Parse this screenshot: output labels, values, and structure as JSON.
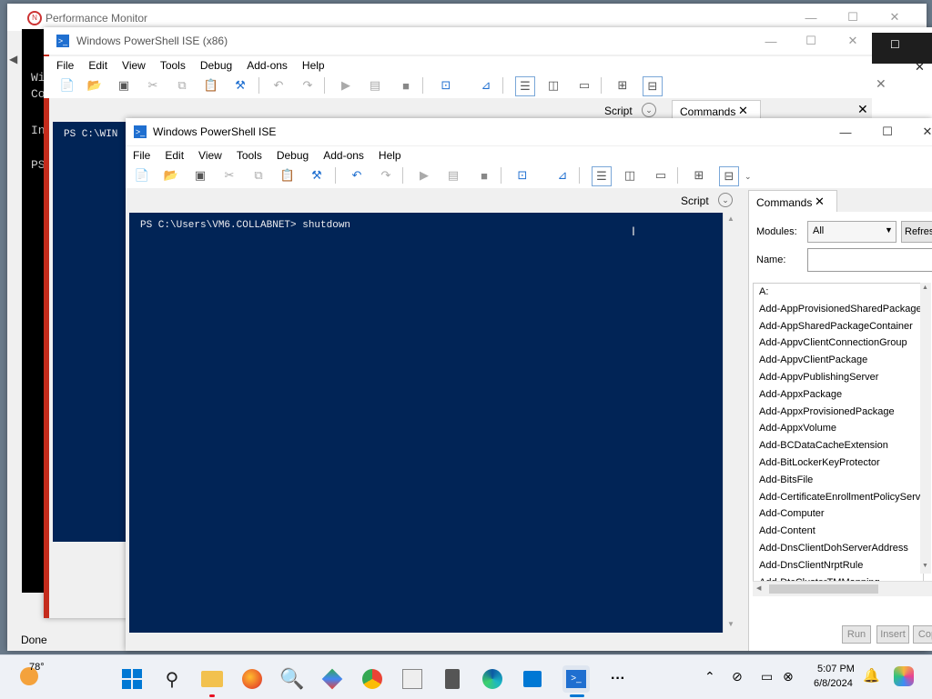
{
  "perfmon": {
    "title": "Performance Monitor",
    "status": "Done"
  },
  "bg_console": {
    "lines": [
      "Wi",
      "Co",
      "In",
      "PS"
    ]
  },
  "ise_back": {
    "title": "Windows PowerShell ISE (x86)",
    "menu": [
      "File",
      "Edit",
      "View",
      "Tools",
      "Debug",
      "Add-ons",
      "Help"
    ],
    "script_label": "Script",
    "commands_tab": "Commands",
    "console_prompt": "PS C:\\WIN"
  },
  "ise_front": {
    "title": "Windows PowerShell ISE",
    "menu": [
      "File",
      "Edit",
      "View",
      "Tools",
      "Debug",
      "Add-ons",
      "Help"
    ],
    "script_label": "Script",
    "console_text": "PS C:\\Users\\VM6.COLLABNET> shutdown",
    "commands": {
      "tab_label": "Commands",
      "modules_label": "Modules:",
      "modules_value": "All",
      "refresh_label": "Refresh",
      "name_label": "Name:",
      "name_value": "",
      "items": [
        "A:",
        "Add-AppProvisionedSharedPackageC",
        "Add-AppSharedPackageContainer",
        "Add-AppvClientConnectionGroup",
        "Add-AppvClientPackage",
        "Add-AppvPublishingServer",
        "Add-AppxPackage",
        "Add-AppxProvisionedPackage",
        "Add-AppxVolume",
        "Add-BCDataCacheExtension",
        "Add-BitLockerKeyProtector",
        "Add-BitsFile",
        "Add-CertificateEnrollmentPolicyServe",
        "Add-Computer",
        "Add-Content",
        "Add-DnsClientDohServerAddress",
        "Add-DnsClientNrptRule",
        "Add-DtcClusterTMMapping"
      ],
      "run_label": "Run",
      "insert_label": "Insert",
      "copy_label": "Cop"
    }
  },
  "taskbar": {
    "weather_temp": "78°",
    "time": "5:07 PM",
    "date": "6/8/2024",
    "more_label": "···"
  },
  "colors": {
    "console_bg": "#012456",
    "console_fg": "#eeedf0",
    "accent": "#0078d4"
  }
}
